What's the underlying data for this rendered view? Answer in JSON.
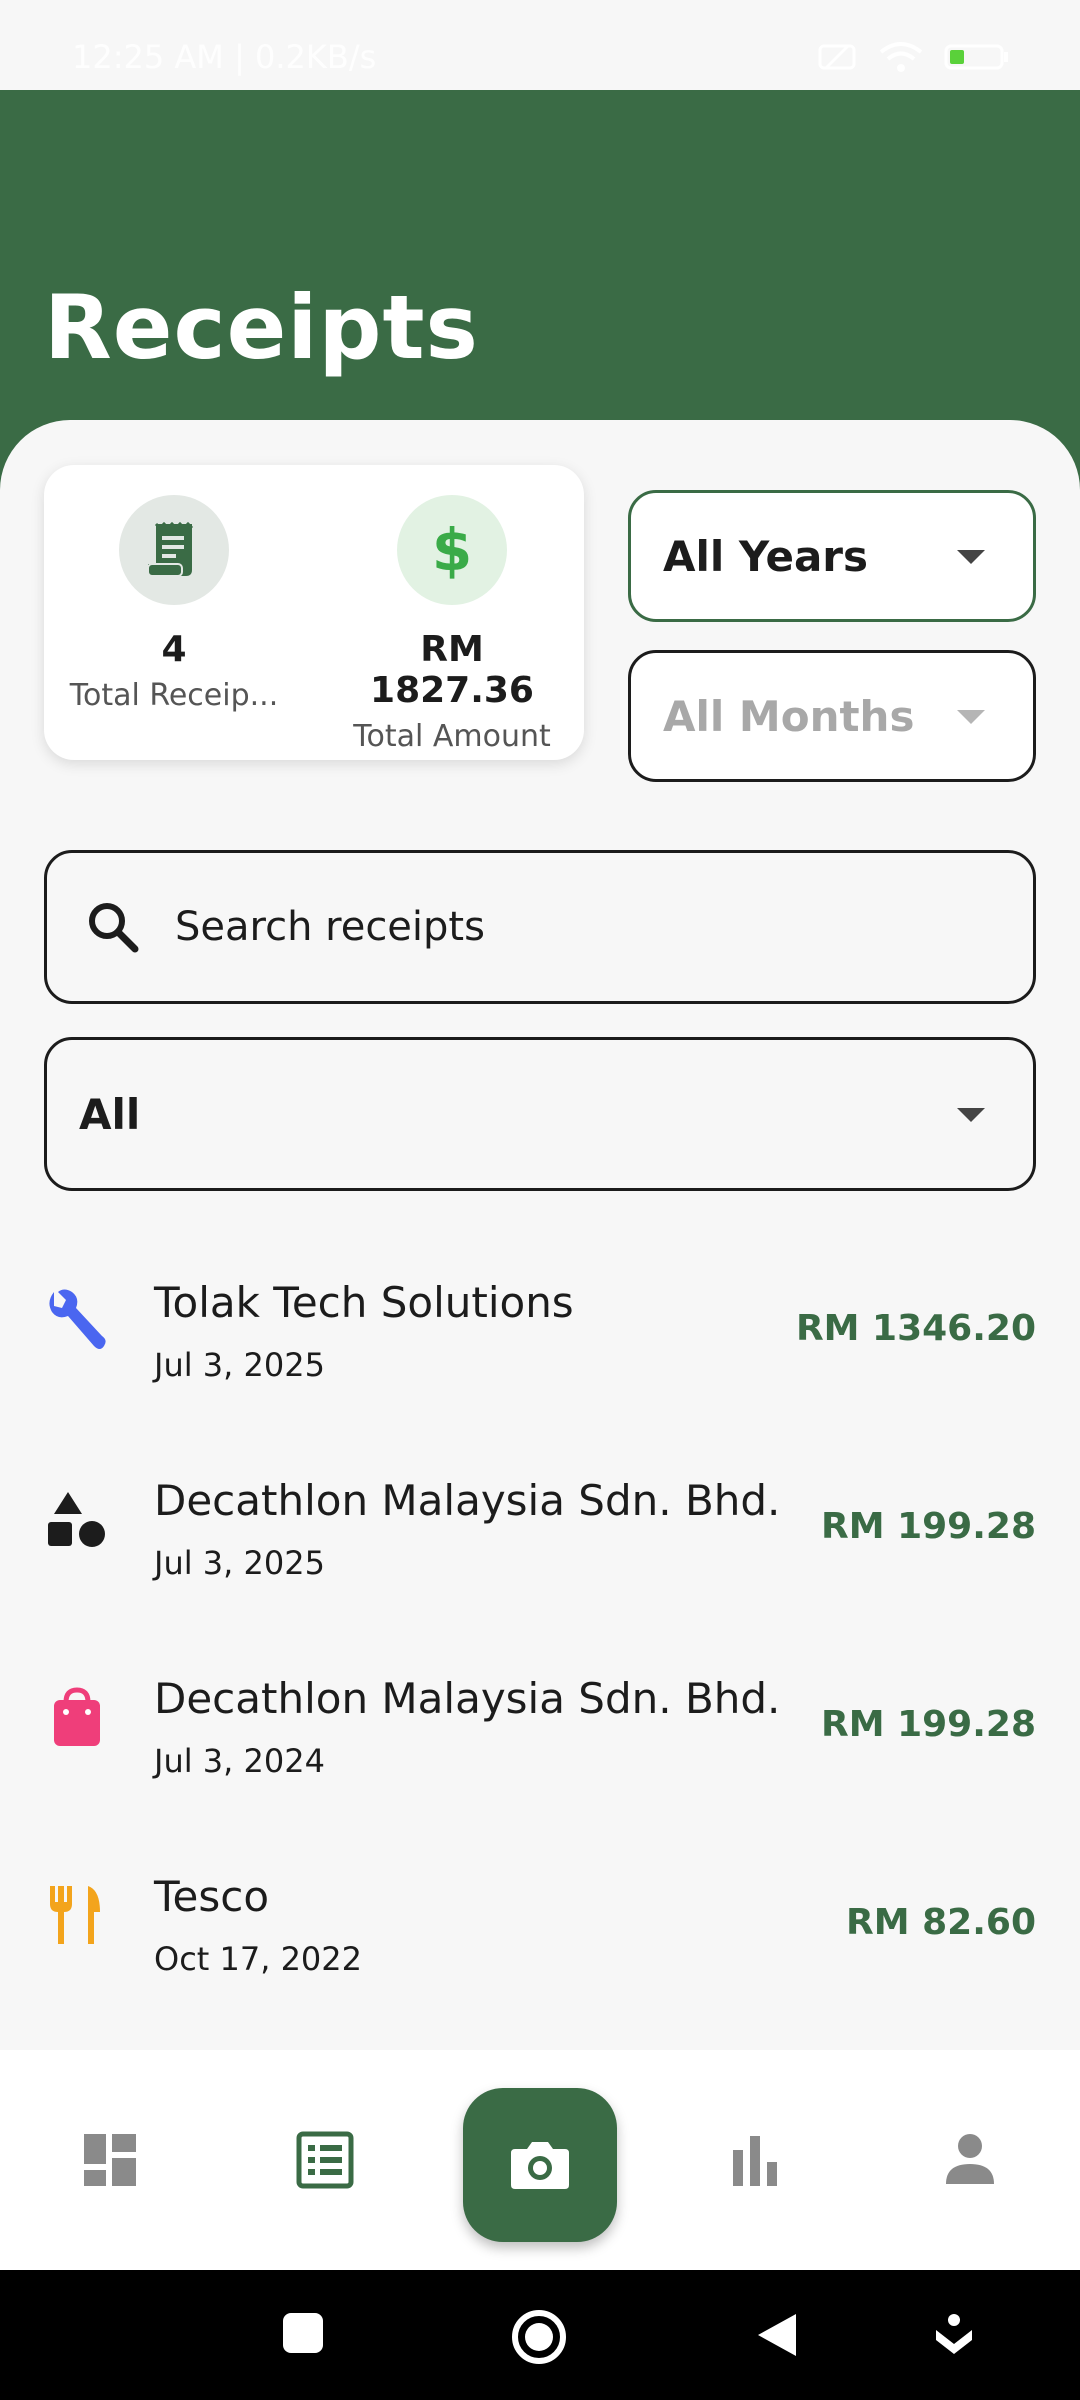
{
  "status": {
    "time": "12:25 AM | 0.2KB/s"
  },
  "header": {
    "title": "Receipts"
  },
  "summary": {
    "count": "4",
    "count_label": "Total Receip...",
    "amount": "RM 1827.36",
    "amount_label": "Total Amount"
  },
  "filters": {
    "year": "All Years",
    "month": "All Months",
    "category": "All"
  },
  "search": {
    "placeholder": "Search receipts"
  },
  "receipts": [
    {
      "name": "Tolak Tech Solutions",
      "date": "Jul 3, 2025",
      "amount": "RM 1346.20",
      "icon": "wrench-icon",
      "color": "#4a66f0"
    },
    {
      "name": "Decathlon Malaysia Sdn. Bhd.",
      "date": "Jul 3, 2025",
      "amount": "RM 199.28",
      "icon": "shapes-icon",
      "color": "#1c1c1c"
    },
    {
      "name": "Decathlon Malaysia Sdn. Bhd.",
      "date": "Jul 3, 2024",
      "amount": "RM 199.28",
      "icon": "shopping-bag-icon",
      "color": "#ef3e7a"
    },
    {
      "name": "Tesco",
      "date": "Oct 17, 2022",
      "amount": "RM 82.60",
      "icon": "restaurant-icon",
      "color": "#f3a41c"
    }
  ],
  "nav": {
    "items": [
      "dashboard-icon",
      "receipts-list-icon",
      "camera-icon",
      "bar-chart-icon",
      "profile-icon"
    ],
    "active": "receipts-list-icon"
  },
  "colors": {
    "primary": "#3a6b45",
    "background": "#f7f7f7"
  }
}
